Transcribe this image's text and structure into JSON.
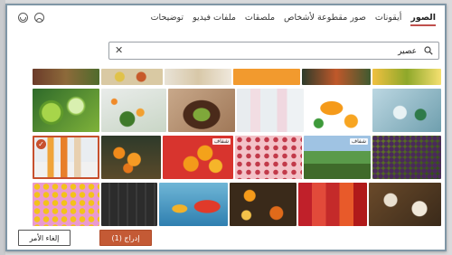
{
  "tabs": [
    "الصور",
    "أيقونات",
    "صور مقطوعة لأشخاص",
    "ملصقات",
    "ملفات فيديو",
    "توضيحات"
  ],
  "active_tab": "الصور",
  "search": {
    "value": "عصير"
  },
  "tiles": [
    {
      "badge": ""
    },
    {
      "badge": ""
    },
    {
      "badge": ""
    },
    {
      "badge": ""
    },
    {
      "badge": ""
    },
    {
      "badge": ""
    },
    {
      "badge": ""
    },
    {
      "badge": ""
    },
    {
      "badge": ""
    },
    {
      "badge": ""
    },
    {
      "badge": ""
    },
    {
      "badge": ""
    },
    {
      "badge": ""
    },
    {
      "badge": "شفاف"
    },
    {
      "badge": ""
    },
    {
      "badge": "شفاف"
    },
    {
      "badge": ""
    },
    {
      "badge": ""
    },
    {
      "badge": ""
    },
    {
      "badge": ""
    },
    {
      "badge": ""
    },
    {
      "badge": ""
    },
    {
      "badge": ""
    },
    {
      "badge": ""
    }
  ],
  "footer": {
    "insert_label": "إدراج (1)",
    "cancel_label": "إلغاء الأمر"
  },
  "colors": {
    "accent": "#c45a35",
    "tab_underline": "#c0504d"
  }
}
